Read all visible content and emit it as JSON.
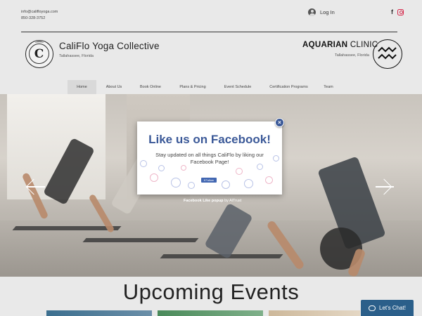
{
  "header": {
    "email": "info@califloyoga.com",
    "phone": "850-328-3752",
    "login_label": "Log In",
    "social": {
      "facebook_glyph": "f",
      "icons": [
        "facebook-icon",
        "instagram-icon"
      ]
    }
  },
  "brand": {
    "logo_letter": "C",
    "name": "CaliFlo Yoga Collective",
    "location": "Tallahassee, Florida"
  },
  "clinic": {
    "name_bold": "AQUARIAN",
    "name_rest": " CLINIC",
    "location": "Tallahassee, Florida"
  },
  "nav": {
    "items": [
      {
        "label": "Home",
        "active": true
      },
      {
        "label": "About Us"
      },
      {
        "label": "Book Online"
      },
      {
        "label": "Plans & Pricing"
      },
      {
        "label": "Event Schedule"
      },
      {
        "label": "Certification Programs"
      },
      {
        "label": "Team"
      }
    ]
  },
  "popup": {
    "title": "Like us on Facebook!",
    "text": "Stay updated on all things CaliFlo by liking our Facebook Page!",
    "follow_label": "Follow",
    "credit_bold": "Facebook Like popup",
    "credit_rest": " by AlTrust",
    "close_glyph": "×"
  },
  "events": {
    "title": "Upcoming Events"
  },
  "chat": {
    "label": "Let's Chat!"
  },
  "colors": {
    "facebook": "#3b5998",
    "chat": "#2b5f8a"
  }
}
